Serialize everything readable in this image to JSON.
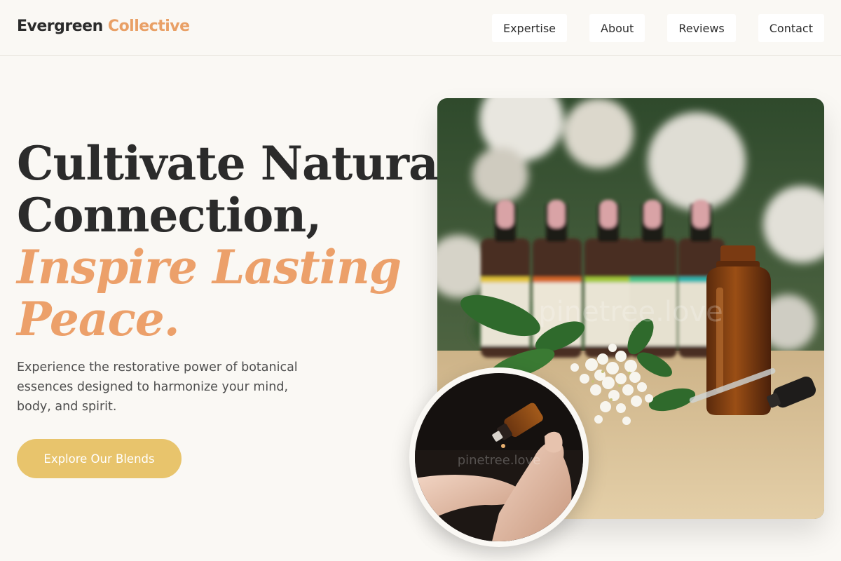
{
  "brand": {
    "name_part1": "Evergreen",
    "name_part2": "Collective"
  },
  "nav": [
    "Expertise",
    "About",
    "Reviews",
    "Contact"
  ],
  "hero": {
    "headline_line1": "Cultivate Natural",
    "headline_line2": "Connection,",
    "headline_accent_line1": "Inspire Lasting",
    "headline_accent_line2": "Peace.",
    "lead": "Experience the restorative power of botanical essences designed to harmonize your mind, body, and spirit.",
    "cta_label": "Explore Our Blends"
  },
  "images": {
    "main_watermark": "pinetree.love",
    "inset_watermark": "pinetree.love"
  },
  "colors": {
    "background": "#faf8f4",
    "brand_accent": "#e9a066",
    "headline_accent": "#eca06a",
    "cta": "#e8c46c",
    "text": "#2b2b2b"
  },
  "icons": [
    "tincture-bottles-photo",
    "dropper-hand-photo"
  ]
}
